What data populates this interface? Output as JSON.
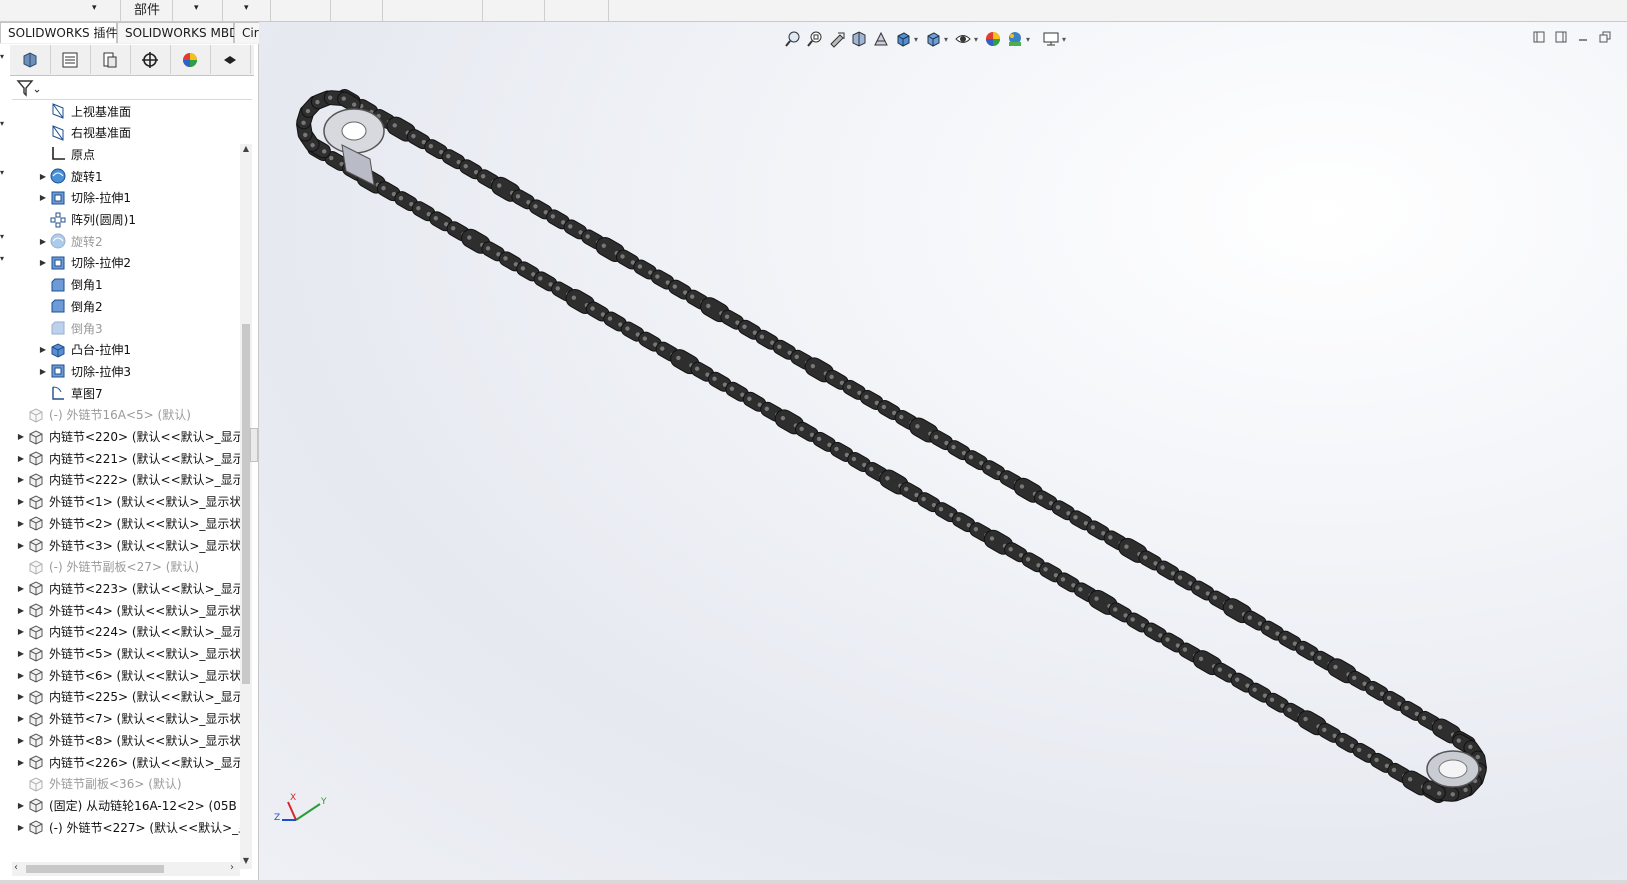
{
  "ribbon": {
    "part_label": "部件"
  },
  "command_tabs": [
    {
      "label": "SOLIDWORKS 插件"
    },
    {
      "label": "SOLIDWORKS MBD"
    },
    {
      "label": "CircuitWorks"
    }
  ],
  "manager_tabs": [
    {
      "icon": "feature-manager-icon"
    },
    {
      "icon": "property-manager-icon"
    },
    {
      "icon": "configuration-manager-icon"
    },
    {
      "icon": "dimxpert-manager-icon"
    },
    {
      "icon": "display-manager-icon"
    },
    {
      "icon": "cam-manager-icon"
    }
  ],
  "filter": {
    "icon": "filter-icon"
  },
  "tree": [
    {
      "label": "上视基准面",
      "icon": "plane-icon",
      "level": 2,
      "expandable": false,
      "suppressed": false
    },
    {
      "label": "右视基准面",
      "icon": "plane-icon",
      "level": 2,
      "expandable": false,
      "suppressed": false
    },
    {
      "label": "原点",
      "icon": "origin-icon",
      "level": 2,
      "expandable": false,
      "suppressed": false
    },
    {
      "label": "旋转1",
      "icon": "revolve-icon",
      "level": 2,
      "expandable": true,
      "suppressed": false
    },
    {
      "label": "切除-拉伸1",
      "icon": "cut-extrude-icon",
      "level": 2,
      "expandable": true,
      "suppressed": false
    },
    {
      "label": "阵列(圆周)1",
      "icon": "pattern-icon",
      "level": 2,
      "expandable": false,
      "suppressed": false
    },
    {
      "label": "旋转2",
      "icon": "revolve-icon",
      "level": 2,
      "expandable": true,
      "suppressed": true
    },
    {
      "label": "切除-拉伸2",
      "icon": "cut-extrude-icon",
      "level": 2,
      "expandable": true,
      "suppressed": false
    },
    {
      "label": "倒角1",
      "icon": "chamfer-icon",
      "level": 2,
      "expandable": false,
      "suppressed": false
    },
    {
      "label": "倒角2",
      "icon": "chamfer-icon",
      "level": 2,
      "expandable": false,
      "suppressed": false
    },
    {
      "label": "倒角3",
      "icon": "chamfer-icon",
      "level": 2,
      "expandable": false,
      "suppressed": true
    },
    {
      "label": "凸台-拉伸1",
      "icon": "boss-extrude-icon",
      "level": 2,
      "expandable": true,
      "suppressed": false
    },
    {
      "label": "切除-拉伸3",
      "icon": "cut-extrude-icon",
      "level": 2,
      "expandable": true,
      "suppressed": false
    },
    {
      "label": "草图7",
      "icon": "sketch-icon",
      "level": 2,
      "expandable": false,
      "suppressed": false
    },
    {
      "label": "(-) 外链节16A<5> (默认)",
      "icon": "part-icon",
      "level": 1,
      "expandable": false,
      "suppressed": true
    },
    {
      "label": "内链节<220> (默认<<默认>_显示",
      "icon": "part-icon",
      "level": 1,
      "expandable": true,
      "suppressed": false
    },
    {
      "label": "内链节<221> (默认<<默认>_显示",
      "icon": "part-icon",
      "level": 1,
      "expandable": true,
      "suppressed": false
    },
    {
      "label": "内链节<222> (默认<<默认>_显示",
      "icon": "part-icon",
      "level": 1,
      "expandable": true,
      "suppressed": false
    },
    {
      "label": "外链节<1> (默认<<默认>_显示状",
      "icon": "part-icon",
      "level": 1,
      "expandable": true,
      "suppressed": false
    },
    {
      "label": "外链节<2> (默认<<默认>_显示状",
      "icon": "part-icon",
      "level": 1,
      "expandable": true,
      "suppressed": false
    },
    {
      "label": "外链节<3> (默认<<默认>_显示状",
      "icon": "part-icon",
      "level": 1,
      "expandable": true,
      "suppressed": false
    },
    {
      "label": "(-) 外链节副板<27> (默认)",
      "icon": "part-icon",
      "level": 1,
      "expandable": false,
      "suppressed": true
    },
    {
      "label": "内链节<223> (默认<<默认>_显示",
      "icon": "part-icon",
      "level": 1,
      "expandable": true,
      "suppressed": false
    },
    {
      "label": "外链节<4> (默认<<默认>_显示状",
      "icon": "part-icon",
      "level": 1,
      "expandable": true,
      "suppressed": false
    },
    {
      "label": "内链节<224> (默认<<默认>_显示",
      "icon": "part-icon",
      "level": 1,
      "expandable": true,
      "suppressed": false
    },
    {
      "label": "外链节<5> (默认<<默认>_显示状",
      "icon": "part-icon",
      "level": 1,
      "expandable": true,
      "suppressed": false
    },
    {
      "label": "外链节<6> (默认<<默认>_显示状",
      "icon": "part-icon",
      "level": 1,
      "expandable": true,
      "suppressed": false
    },
    {
      "label": "内链节<225> (默认<<默认>_显示",
      "icon": "part-icon",
      "level": 1,
      "expandable": true,
      "suppressed": false
    },
    {
      "label": "外链节<7> (默认<<默认>_显示状",
      "icon": "part-icon",
      "level": 1,
      "expandable": true,
      "suppressed": false
    },
    {
      "label": "外链节<8> (默认<<默认>_显示状",
      "icon": "part-icon",
      "level": 1,
      "expandable": true,
      "suppressed": false
    },
    {
      "label": "内链节<226> (默认<<默认>_显示",
      "icon": "part-icon",
      "level": 1,
      "expandable": true,
      "suppressed": false
    },
    {
      "label": "外链节副板<36> (默认)",
      "icon": "part-icon",
      "level": 1,
      "expandable": false,
      "suppressed": true
    },
    {
      "label": "(固定) 从动链轮16A-12<2> (05B",
      "icon": "part-icon",
      "level": 1,
      "expandable": true,
      "suppressed": false
    },
    {
      "label": "(-) 外链节<227> (默认<<默认>_显",
      "icon": "part-icon",
      "level": 1,
      "expandable": true,
      "suppressed": false
    }
  ],
  "heads_up_toolbar": [
    {
      "icon": "zoom-to-fit-icon",
      "dropdown": false
    },
    {
      "icon": "zoom-to-area-icon",
      "dropdown": false
    },
    {
      "icon": "previous-view-icon",
      "dropdown": false
    },
    {
      "icon": "section-view-icon",
      "dropdown": false
    },
    {
      "icon": "dynamic-annotation-icon",
      "dropdown": false
    },
    {
      "icon": "view-orientation-icon",
      "dropdown": true
    },
    {
      "icon": "display-style-icon",
      "dropdown": true
    },
    {
      "icon": "hide-show-items-icon",
      "dropdown": true
    },
    {
      "icon": "edit-appearance-icon",
      "dropdown": false
    },
    {
      "icon": "apply-scene-icon",
      "dropdown": true
    },
    {
      "icon": "view-settings-icon",
      "dropdown": true
    }
  ],
  "window_controls": [
    {
      "icon": "tile-left-icon"
    },
    {
      "icon": "tile-right-icon"
    },
    {
      "icon": "minimize-icon"
    },
    {
      "icon": "restore-icon"
    }
  ],
  "triad": {
    "x_label": "X",
    "y_label": "Y",
    "z_label": "Z"
  },
  "colors": {
    "chain": "#2e2e2e",
    "selection_blue": "#1f6fd1",
    "background_top": "#ffffff",
    "background_bottom": "#e6e9f0"
  }
}
